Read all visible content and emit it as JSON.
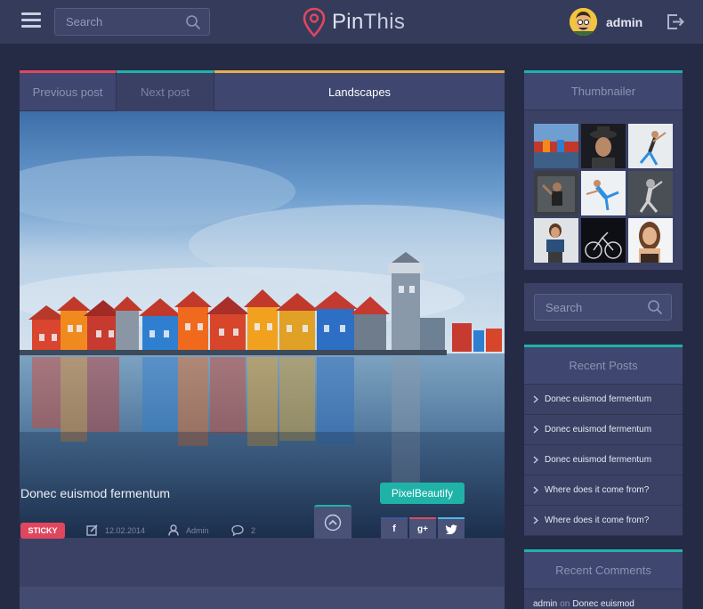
{
  "header": {
    "search_placeholder": "Search",
    "logo_prefix": "Pin",
    "logo_suffix": "This",
    "username": "admin"
  },
  "post": {
    "tabs": {
      "previous": "Previous post",
      "next": "Next post",
      "category": "Landscapes"
    },
    "title": "Donec euismod fermentum",
    "author_button": "PixelBeautify",
    "sticky_label": "STICKY",
    "date": "12.02.2014",
    "author": "Admin",
    "comments_count": "2",
    "share": {
      "facebook": "f",
      "googleplus": "g+",
      "twitter": "t"
    }
  },
  "sidebar": {
    "thumbnailer_title": "Thumbnailer",
    "search_placeholder": "Search",
    "recent_posts_title": "Recent Posts",
    "recent_posts": [
      "Donec euismod fermentum",
      "Donec euismod fermentum",
      "Donec euismod fermentum",
      "Where does it come from?",
      "Where does it come from?"
    ],
    "recent_comments_title": "Recent Comments",
    "recent_comment": {
      "author": "admin",
      "on": "on",
      "post": "Donec euismod"
    }
  },
  "colors": {
    "background": "#262b45",
    "panel": "#3d4466",
    "accent_teal": "#1fb3a8",
    "accent_red": "#e0475f",
    "accent_yellow": "#e7b04a"
  }
}
